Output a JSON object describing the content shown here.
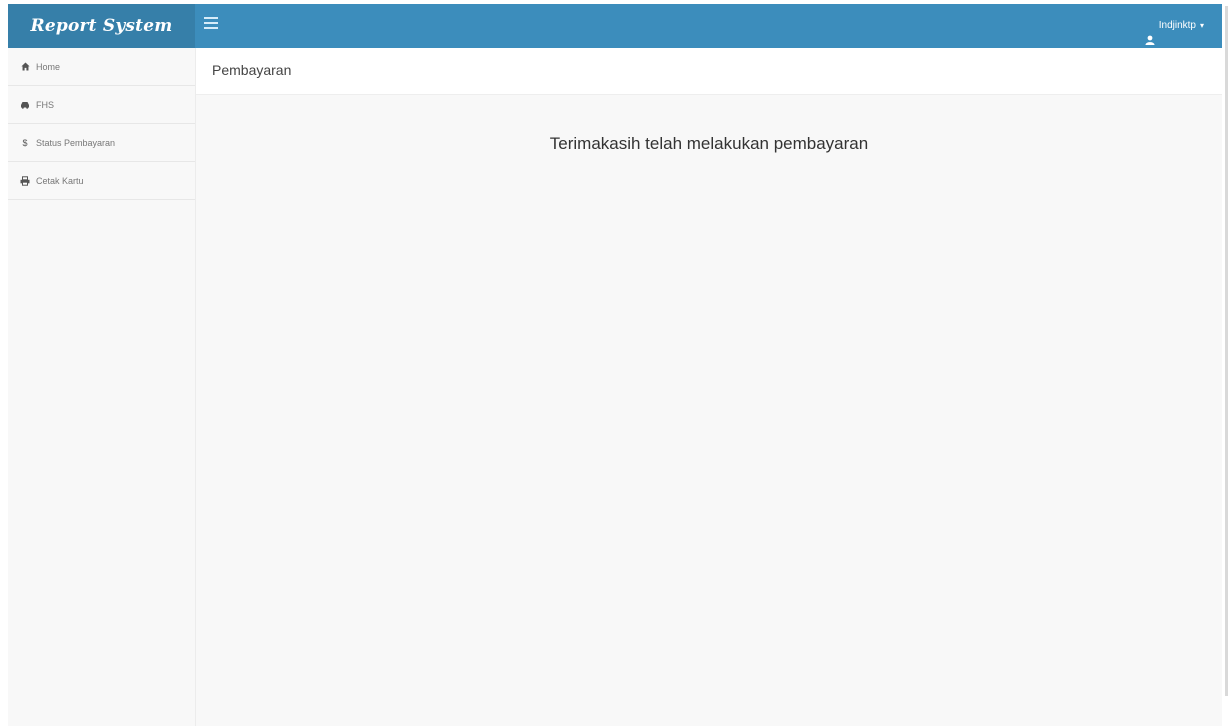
{
  "navbar": {
    "brand": "Report System",
    "user_label": "Indjinktp",
    "user_caret": "▾"
  },
  "sidebar": {
    "items": [
      {
        "label": "Home",
        "icon": "home-icon"
      },
      {
        "label": "FHS",
        "icon": "car-icon"
      },
      {
        "label": "Status Pembayaran",
        "icon": "dollar-icon"
      },
      {
        "label": "Cetak Kartu",
        "icon": "print-icon"
      }
    ]
  },
  "main": {
    "page_title": "Pembayaran",
    "message": "Terimakasih telah melakukan pembayaran"
  },
  "colors": {
    "navbar": "#3c8dbc",
    "brand_bg": "#367fa9",
    "sidebar_bg": "#f8f8f8",
    "content_bg": "#f8f8f8"
  }
}
